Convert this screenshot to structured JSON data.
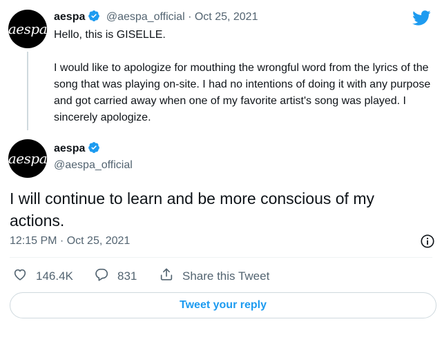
{
  "parent_tweet": {
    "avatar_text": "aespa",
    "display_name": "aespa",
    "handle": "@aespa_official",
    "separator": "·",
    "date": "Oct 25, 2021",
    "line1": "Hello, this is GISELLE.",
    "paragraph": "I would like to apologize for mouthing the wrongful word from the lyrics of the song that was playing on-site. I had no intentions of doing it with any purpose and got carried away when one of my favorite artist's song was played. I sincerely apologize."
  },
  "main_tweet": {
    "avatar_text": "aespa",
    "display_name": "aespa",
    "handle": "@aespa_official",
    "text": "I will continue to learn and be more conscious of my actions.",
    "timestamp": "12:15 PM · Oct 25, 2021"
  },
  "actions": {
    "likes": "146.4K",
    "replies": "831",
    "share_label": "Share this Tweet"
  },
  "reply_button": {
    "label": "Tweet your reply"
  },
  "icons": {
    "brand": "twitter-bird-icon",
    "verified": "verified-badge-icon",
    "info": "info-icon",
    "like": "heart-icon",
    "reply": "reply-bubble-icon",
    "share": "share-icon"
  },
  "colors": {
    "accent": "#1d9bf0",
    "text": "#0f1419",
    "muted": "#536471"
  }
}
